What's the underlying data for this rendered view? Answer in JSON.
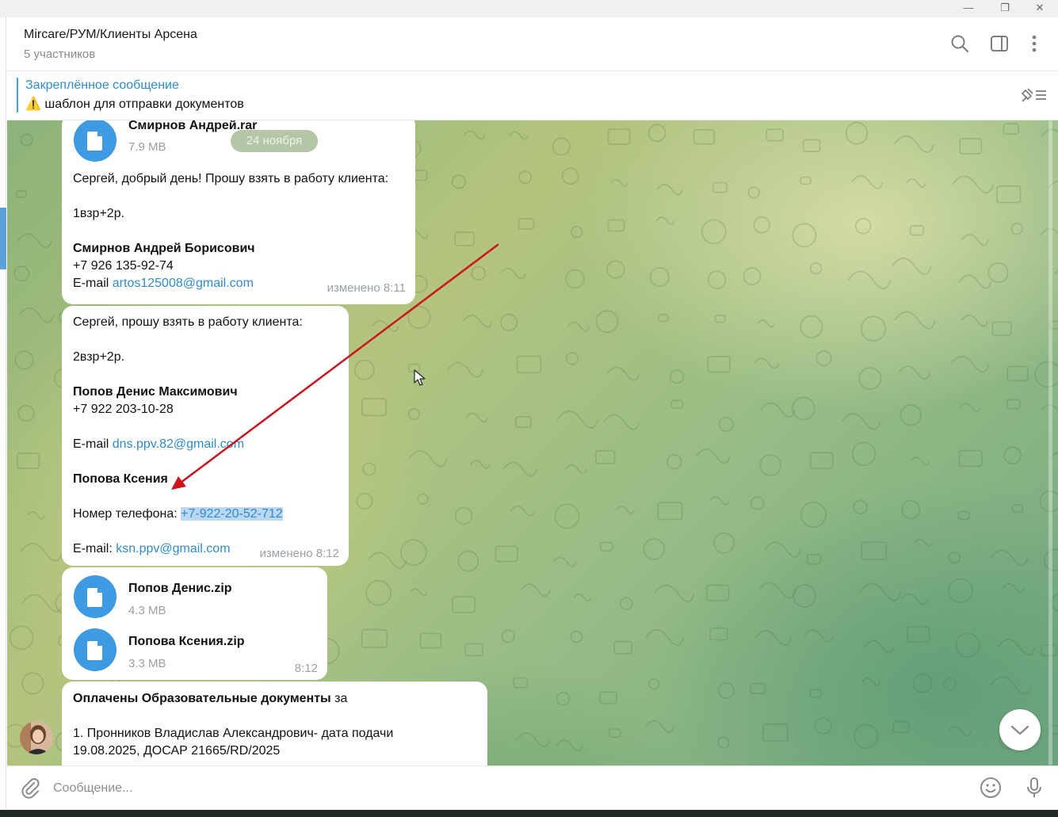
{
  "window": {
    "minimize_glyph": "—",
    "restore_glyph": "❐",
    "close_glyph": "✕"
  },
  "header": {
    "title": "Mircare/РУМ/Клиенты Арсена",
    "subtitle": "5 участников",
    "icons": [
      "search-icon",
      "sidebar-toggle-icon",
      "more-vertical-icon"
    ]
  },
  "pinned": {
    "title": "Закреплённое сообщение",
    "text": "⚠️ шаблон для отправки документов",
    "icon": "unpin-list-icon"
  },
  "date_chip": "24 ноября",
  "messages": {
    "m1": {
      "file_name": "Смирнов Андрей.rar",
      "file_size": "7.9 MB",
      "line1": "Сергей, добрый день!  Прошу взять в работу клиента:",
      "line2": "1взр+2р.",
      "name": "Смирнов Андрей Борисович",
      "phone": "+7 926 135-92-74",
      "email_label": "E-mail ",
      "email": "artos125008@gmail.com",
      "meta": "изменено 8:11"
    },
    "m2": {
      "line1": "Сергей, прошу взять в работу клиента:",
      "line2": "2взр+2р.",
      "name": "Попов Денис Максимович",
      "phone": "+7 922 203-10-28",
      "email_label": "E-mail ",
      "email": "dns.ppv.82@gmail.com",
      "name2": "Попова Ксения",
      "phone_label": "Номер телефона: ",
      "phone2": "+7-922-20-52-712",
      "email2_label": "E-mail:  ",
      "email2": "ksn.ppv@gmail.com",
      "meta": "изменено 8:12"
    },
    "m3": {
      "files": [
        {
          "name": "Попов Денис.zip",
          "size": "4.3 MB"
        },
        {
          "name": "Попова Ксения.zip",
          "size": "3.3 MB"
        }
      ],
      "meta": "8:12"
    },
    "m4": {
      "heading_bold": "Оплачены Образовательные документы",
      "heading_rest": " за",
      "line1": "1. Пронников Владислав Александрович- дата подачи",
      "line2": "19.08.2025, ДОСАР 21665/RD/2025"
    }
  },
  "composer": {
    "placeholder": "Сообщение...",
    "icons": [
      "attach-icon",
      "emoji-icon",
      "microphone-icon"
    ]
  },
  "colors": {
    "accent": "#2d8ccd",
    "file_icon": "#3e9be3",
    "annotation_arrow": "#d0121b"
  }
}
